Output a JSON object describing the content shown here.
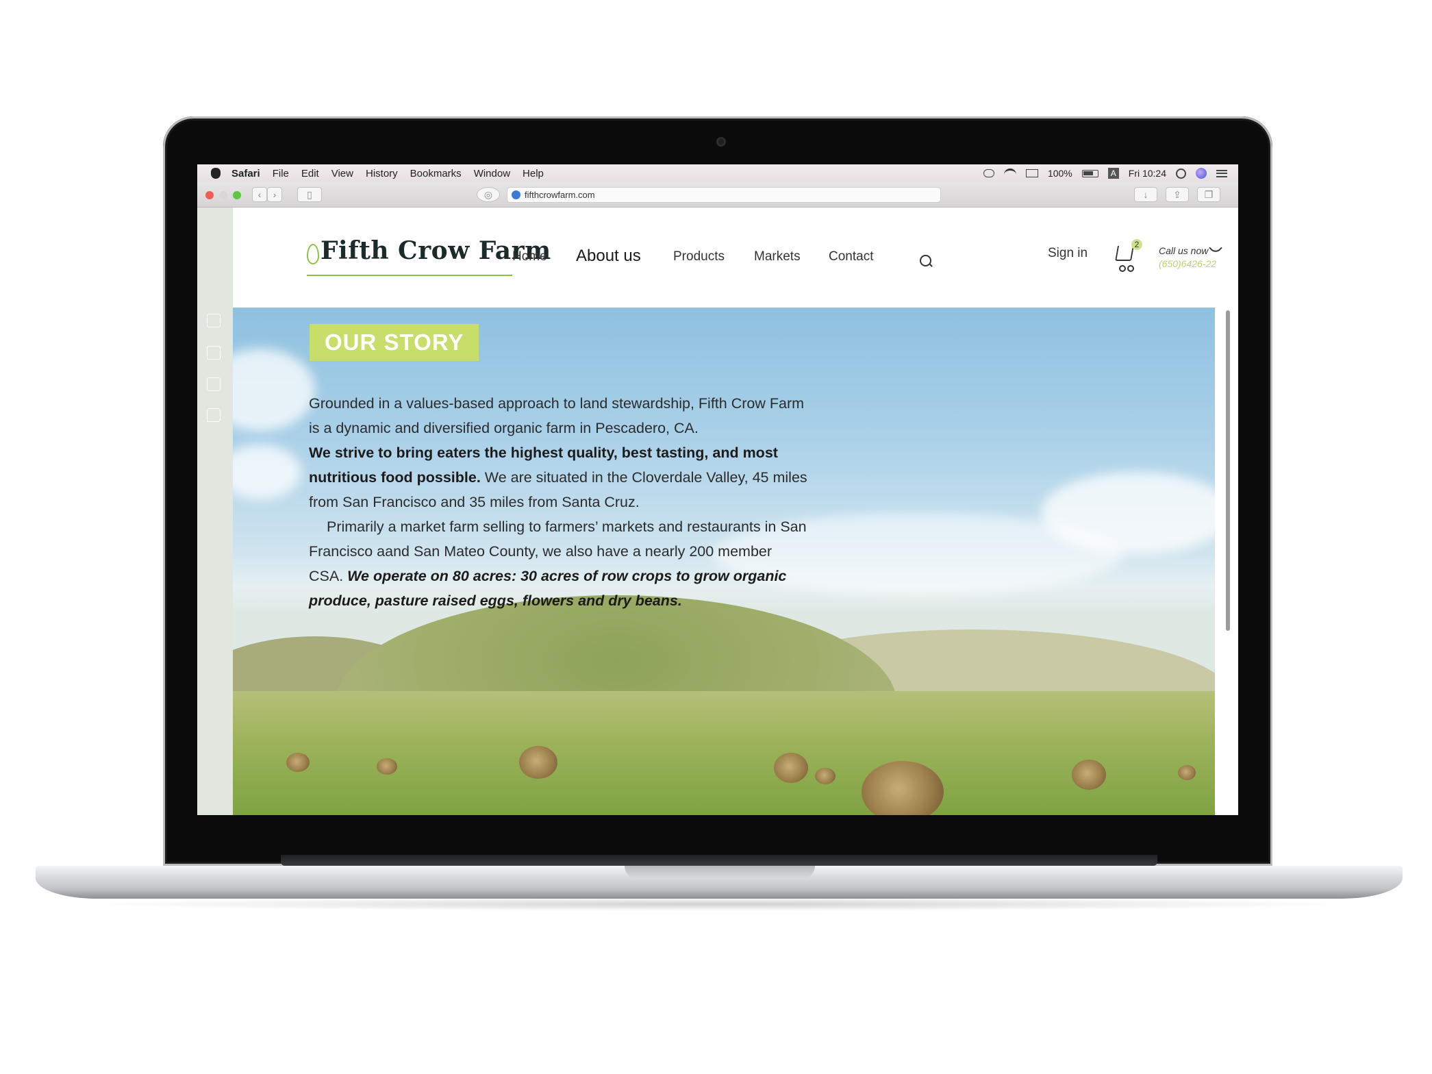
{
  "menubar": {
    "app_name": "Safari",
    "items": [
      "File",
      "Edit",
      "View",
      "History",
      "Bookmarks",
      "Window",
      "Help"
    ],
    "battery": "100%",
    "input_source": "A",
    "clock": "Fri 10:24"
  },
  "toolbar": {
    "url": "fifthcrowfarm.com"
  },
  "site": {
    "logo": "Fifth Crow Farm",
    "nav": [
      "Home",
      "About us",
      "Products",
      "Markets",
      "Contact"
    ],
    "active_nav": "About us",
    "sign_in": "Sign in",
    "cart_count": "2",
    "call_label": "Call us now",
    "phone": "(650)6426-22",
    "accent_color": "#c8de6a",
    "social_icons": [
      "facebook-icon",
      "twitter-icon",
      "mail-icon",
      "chat-icon"
    ]
  },
  "story": {
    "tag": "OUR STORY",
    "p1": "Grounded in a values-based approach to land stewardship, Fifth Crow Farm is a dynamic and diversified organic farm in Pescadero, CA.",
    "p2_bold": "We strive to bring eaters the highest quality, best tasting, and most nutritious food possible.",
    "p2_rest": " We are situated in the Cloverdale Valley, 45 miles from San Francisco and 35 miles from Santa Cruz.",
    "p3": "Primarily a market farm selling to farmers’ markets and restaurants in San Francisco aand San Mateo County, we also have a nearly 200 member CSA. ",
    "p3_emphasis": "We operate on 80 acres: 30 acres of row crops to grow organic produce, pasture raised eggs, flowers and dry beans."
  }
}
